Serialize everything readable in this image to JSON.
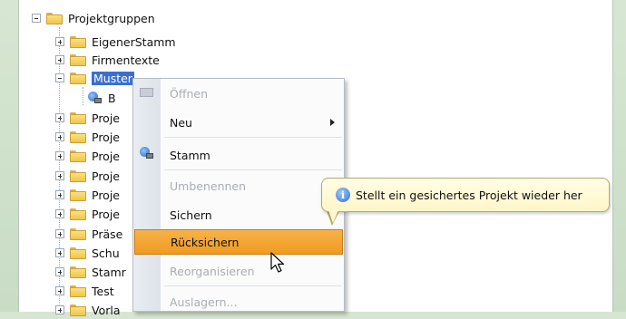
{
  "tree": {
    "root_label": "Projektgruppen",
    "items": [
      {
        "label": "EigenerStamm"
      },
      {
        "label": "Firmentexte"
      },
      {
        "label": "Muster"
      },
      {
        "label": "B"
      },
      {
        "label": "Proje"
      },
      {
        "label": "Proje"
      },
      {
        "label": "Proje"
      },
      {
        "label": "Proje"
      },
      {
        "label": "Proje"
      },
      {
        "label": "Proje"
      },
      {
        "label": "Präse"
      },
      {
        "label": "Schu"
      },
      {
        "label": "Stamr"
      },
      {
        "label": "Test"
      },
      {
        "label": "Vorla"
      }
    ]
  },
  "context_menu": {
    "items": [
      {
        "label": "Öffnen",
        "enabled": false
      },
      {
        "label": "Neu",
        "enabled": true
      },
      {
        "label": "Stamm",
        "enabled": true
      },
      {
        "label": "Umbenennen",
        "enabled": false
      },
      {
        "label": "Sichern",
        "enabled": true
      },
      {
        "label": "Rücksichern",
        "enabled": true,
        "highlighted": true
      },
      {
        "label": "Reorganisieren",
        "enabled": false
      },
      {
        "label": "Auslagern...",
        "enabled": false
      }
    ]
  },
  "tooltip": {
    "text": "Stellt ein gesichertes Projekt wieder her"
  },
  "colors": {
    "highlight": "#f09b20",
    "selection": "#3a6fd1",
    "tooltip_bg": "#fff6c8"
  }
}
